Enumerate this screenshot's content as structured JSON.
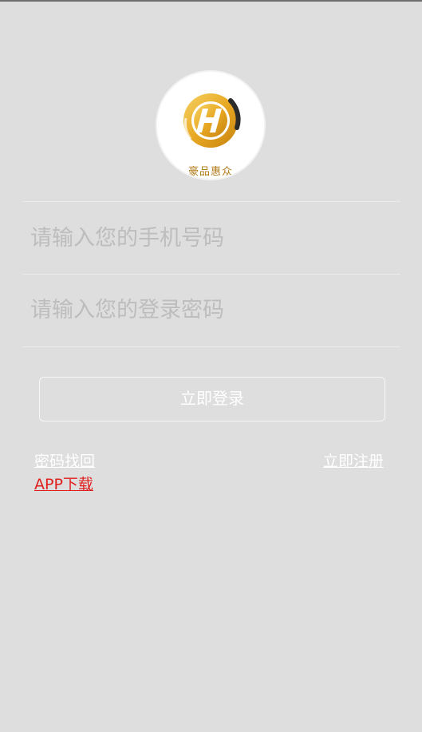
{
  "logo": {
    "text": "豪品惠众"
  },
  "form": {
    "phone_placeholder": "请输入您的手机号码",
    "password_placeholder": "请输入您的登录密码",
    "login_label": "立即登录"
  },
  "links": {
    "recover_password": "密码找回",
    "register": "立即注册",
    "app_download": "APP下载"
  },
  "colors": {
    "background": "#dedede",
    "link_red": "#e11e1e",
    "logo_gold": "#e8a823"
  },
  "icons": {
    "logo": "golden-h-circle-logo"
  }
}
